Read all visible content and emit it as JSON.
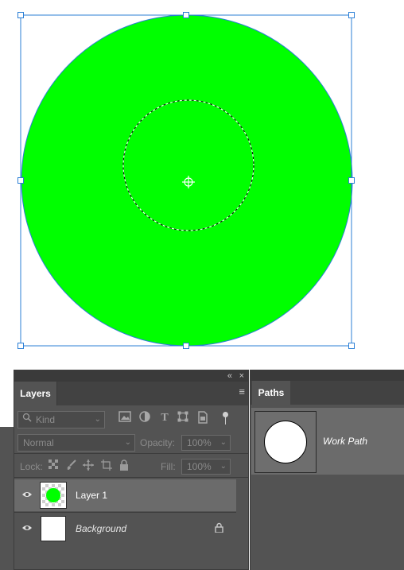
{
  "layers_panel": {
    "collapse_glyph": "«",
    "close_glyph": "×",
    "tab_label": "Layers",
    "menu_glyph": "≡",
    "filter_kind": "Kind",
    "blend_mode": "Normal",
    "opacity_label": "Opacity:",
    "opacity_value": "100%",
    "lock_label": "Lock:",
    "fill_label": "Fill:",
    "fill_value": "100%",
    "layers": [
      {
        "name": "Layer 1",
        "selected": true,
        "visible": true
      },
      {
        "name": "Background",
        "selected": false,
        "visible": true,
        "locked": true
      }
    ]
  },
  "paths_panel": {
    "tab_label": "Paths",
    "paths": [
      {
        "name": "Work Path"
      }
    ]
  },
  "icons": {
    "eye": "eye-icon",
    "lock": "lock-icon",
    "search": "search-icon"
  },
  "colors": {
    "circle_fill": "#00ff00",
    "selection_frame": "#2b7fd6",
    "panel_bg": "#535353"
  }
}
